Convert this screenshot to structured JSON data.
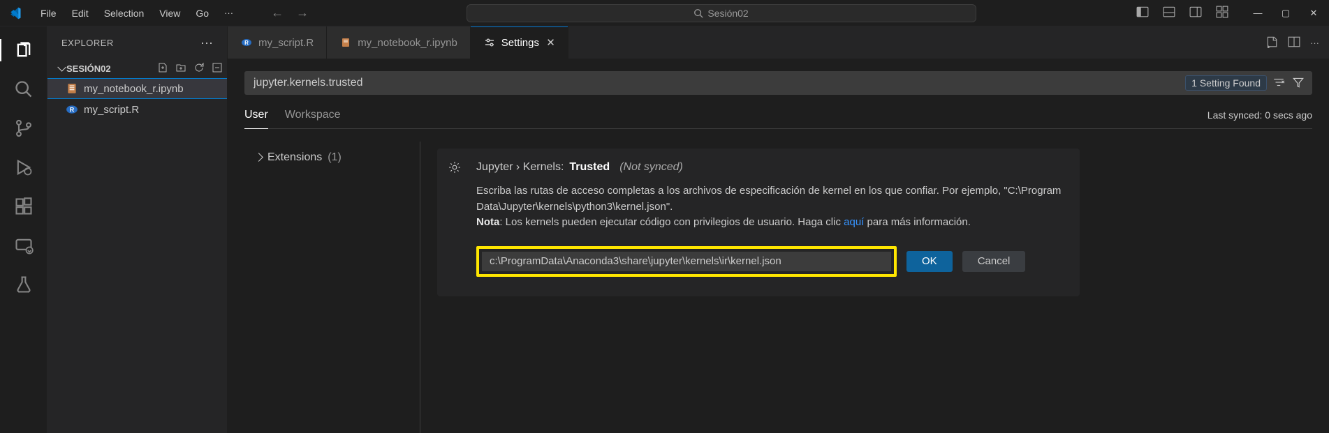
{
  "menu": {
    "file": "File",
    "edit": "Edit",
    "selection": "Selection",
    "view": "View",
    "go": "Go"
  },
  "title_search": "Sesión02",
  "explorer": {
    "title": "EXPLORER",
    "folder": "SESIÓN02",
    "files": [
      {
        "name": "my_notebook_r.ipynb",
        "icon": "notebook"
      },
      {
        "name": "my_script.R",
        "icon": "r"
      }
    ]
  },
  "tabs": [
    {
      "label": "my_script.R",
      "icon": "r"
    },
    {
      "label": "my_notebook_r.ipynb",
      "icon": "notebook"
    },
    {
      "label": "Settings",
      "icon": "settings",
      "active": true,
      "closeable": true
    }
  ],
  "settings": {
    "search_value": "jupyter.kernels.trusted",
    "found_label": "1 Setting Found",
    "scope_user": "User",
    "scope_workspace": "Workspace",
    "sync_status": "Last synced: 0 secs ago",
    "toc_extensions_label": "Extensions",
    "toc_extensions_count": "(1)",
    "item": {
      "path": "Jupyter › Kernels:",
      "name": "Trusted",
      "not_synced": "(Not synced)",
      "desc_line1": "Escriba las rutas de acceso completas a los archivos de especificación de kernel en los que confiar. Por ejemplo, \"C:\\Program Data\\Jupyter\\kernels\\python3\\kernel.json\".",
      "desc_bold": "Nota",
      "desc_line2a": ": Los kernels pueden ejecutar código con privilegios de usuario. Haga clic ",
      "desc_link": "aquí",
      "desc_line2b": " para más información.",
      "input_value": "c:\\ProgramData\\Anaconda3\\share\\jupyter\\kernels\\ir\\kernel.json",
      "ok_label": "OK",
      "cancel_label": "Cancel"
    }
  }
}
